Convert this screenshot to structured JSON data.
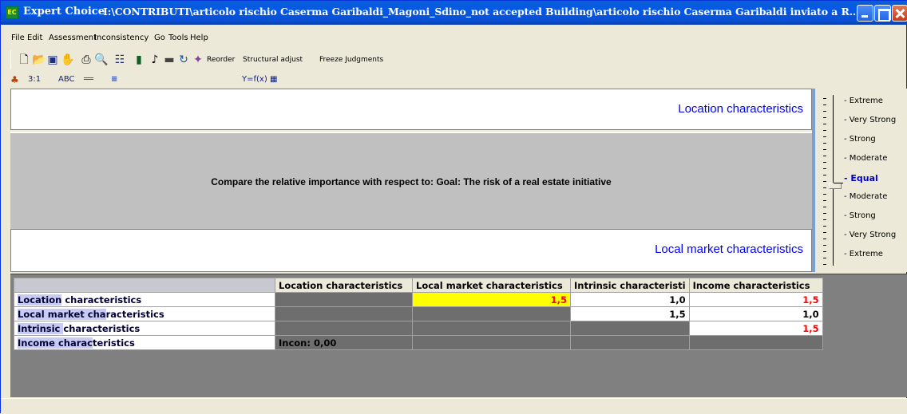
{
  "window": {
    "app_name": "Expert Choice",
    "title_path": "I:\\CONTRIBUTI\\articolo rischio Caserma Garibaldi_Magoni_Sdino_not accepted Building\\articolo rischio Caserma Garibaldi inviato a Real Estate Financ..."
  },
  "menu": [
    "File",
    "Edit",
    "Assessment",
    "Inconsistency",
    "Go",
    "Tools",
    "Help"
  ],
  "toolbar": {
    "reorder_label": "Reorder",
    "structural_adjust_label": "Structural adjust",
    "freeze_label": "Freeze Judgments"
  },
  "tabs": {
    "numeric": "3:1",
    "verbal": "ABC",
    "formula": "Y=f(x)"
  },
  "compare": {
    "top_element": "Location characteristics",
    "bottom_element": "Local market characteristics",
    "prompt": "Compare the relative importance  with respect to: Goal: The risk of a real estate initiative"
  },
  "scale": {
    "labels": [
      "Extreme",
      "Very Strong",
      "Strong",
      "Moderate",
      "Equal",
      "Moderate",
      "Strong",
      "Very Strong",
      "Extreme"
    ],
    "selected_index": 4
  },
  "grid": {
    "columns": [
      "Location characteristics",
      "Local market characteristics",
      "Intrinsic characteristi",
      "Income characteristics"
    ],
    "rows": [
      {
        "hl": "Location",
        "rest": " characteristics",
        "cells": [
          "",
          "1,5",
          "1,0",
          "1,5"
        ]
      },
      {
        "hl": "Local market cha",
        "rest": "racteristics",
        "cells": [
          "",
          "",
          "1,5",
          "1,0"
        ]
      },
      {
        "hl": "Intrinsic ",
        "rest": "characteristics",
        "cells": [
          "",
          "",
          "",
          "1,5"
        ]
      },
      {
        "hl": "Income charac",
        "rest": "teristics",
        "cells": [
          "Incon: 0,00",
          "",
          "",
          ""
        ]
      }
    ]
  },
  "colors": {
    "title_bar": "#0a5fd6",
    "selected_cell": "#ffff00",
    "inverse_value": "#ff0000",
    "element_text": "#0000ff"
  }
}
